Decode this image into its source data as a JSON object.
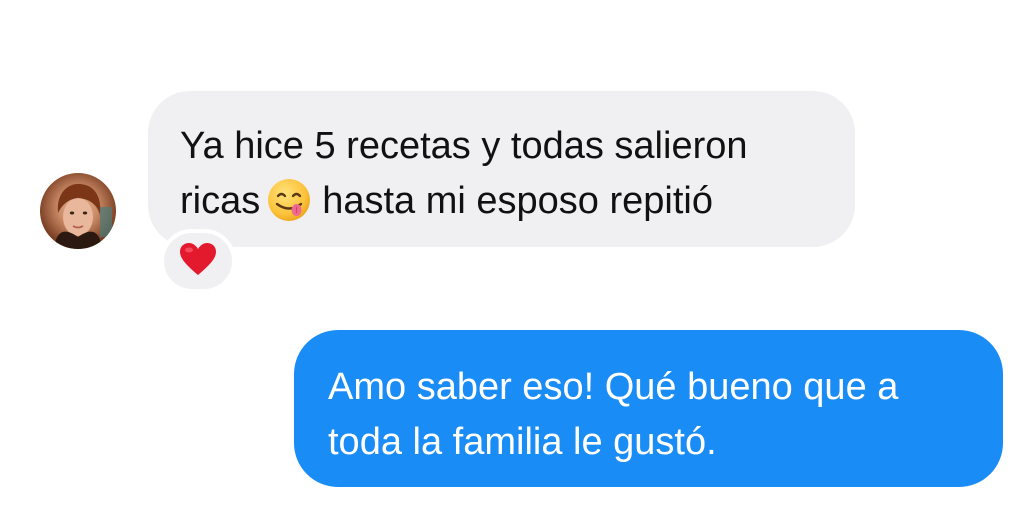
{
  "conversation": {
    "incoming": {
      "line1": "Ya hice 5 recetas y todas salieron",
      "line2_before": "ricas",
      "emoji": "face-savoring-food-icon",
      "line2_after": "hasta mi esposo repitió",
      "reaction": "heart-icon"
    },
    "outgoing": {
      "line1": "Amo saber eso! Qué bueno que a",
      "line2": "toda la familia le gustó."
    }
  },
  "colors": {
    "incoming_bubble": "#f0f0f2",
    "outgoing_bubble": "#1a8cf6",
    "heart": "#e3192d"
  }
}
